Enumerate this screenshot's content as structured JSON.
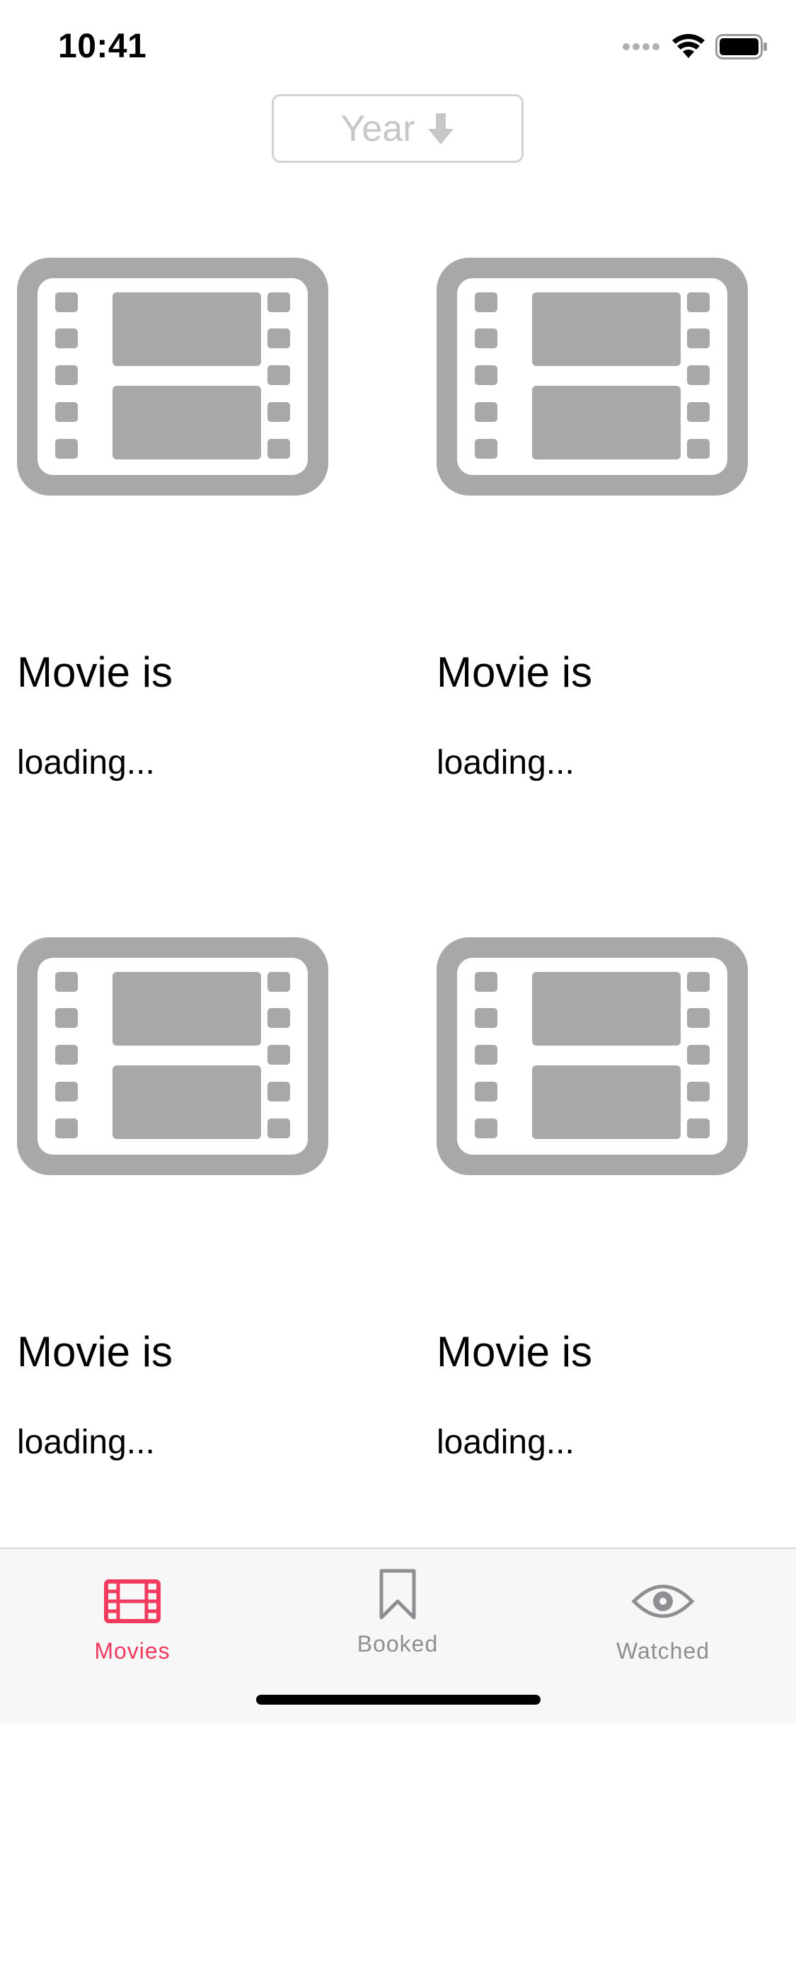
{
  "status_bar": {
    "time": "10:41"
  },
  "sort_button": {
    "label": "Year",
    "icon": "arrow-down-icon"
  },
  "movies": [
    {
      "title": "Movie is",
      "subtitle": "loading...",
      "icon": "film-icon"
    },
    {
      "title": "Movie is",
      "subtitle": "loading...",
      "icon": "film-icon"
    },
    {
      "title": "Movie is",
      "subtitle": "loading...",
      "icon": "film-icon"
    },
    {
      "title": "Movie is",
      "subtitle": "loading...",
      "icon": "film-icon"
    }
  ],
  "tab_bar": {
    "tabs": [
      {
        "label": "Movies",
        "icon": "film-icon",
        "selected": true
      },
      {
        "label": "Booked",
        "icon": "bookmark-icon",
        "selected": false
      },
      {
        "label": "Watched",
        "icon": "eye-icon",
        "selected": false
      }
    ]
  },
  "colors": {
    "accent": "#f23a5f",
    "inactive": "#8e8e93",
    "placeholder": "#a8a8a8",
    "sort_text": "#c7c7c7"
  }
}
